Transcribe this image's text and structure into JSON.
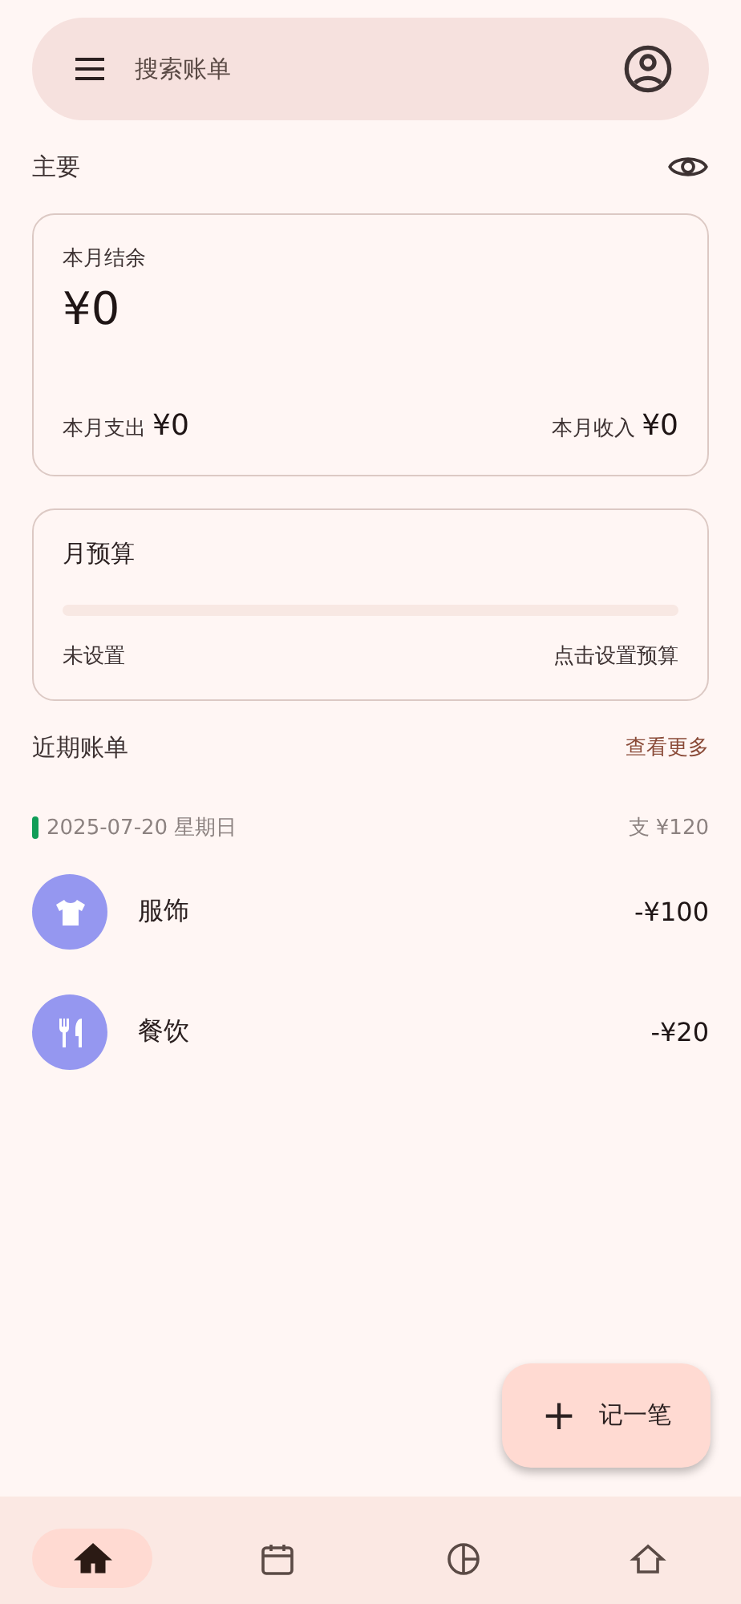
{
  "search": {
    "placeholder": "搜索账单"
  },
  "main_section": {
    "title": "主要"
  },
  "balance_card": {
    "label": "本月结余",
    "amount": "¥0",
    "expense_label": "本月支出",
    "expense": "¥0",
    "income_label": "本月收入",
    "income": "¥0"
  },
  "budget_card": {
    "title": "月预算",
    "level": 0,
    "status": "未设置",
    "action": "点击设置预算"
  },
  "recent": {
    "title": "近期账单",
    "more": "查看更多",
    "groups": [
      {
        "date": "2025-07-20 星期日",
        "total": "支 ¥120",
        "color": "#0f9d58",
        "items": [
          {
            "kind": "clothing",
            "name": "服饰",
            "amount": "-¥100"
          },
          {
            "kind": "food",
            "name": "餐饮",
            "amount": "-¥20"
          }
        ]
      }
    ]
  },
  "fab": {
    "icon": "+",
    "label": "记一笔"
  },
  "nav": [
    {
      "kind": "home",
      "selected": true
    },
    {
      "kind": "calendar",
      "selected": false
    },
    {
      "kind": "chart",
      "selected": false
    },
    {
      "kind": "house",
      "selected": false
    }
  ]
}
